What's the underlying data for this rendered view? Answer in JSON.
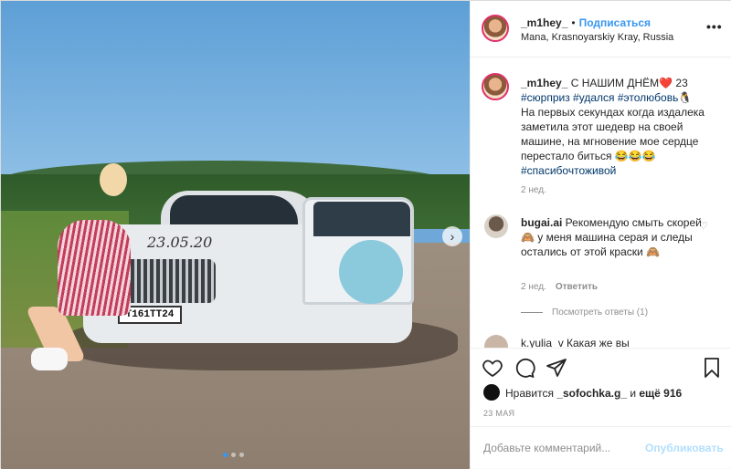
{
  "post": {
    "username": "_m1hey_",
    "separator": "•",
    "follow_label": "Подписаться",
    "location": "Mana, Krasnoyarskiy Kray, Russia",
    "more_icon": "more-horizontal-icon"
  },
  "photo": {
    "plate": "Т161ТТ24",
    "writing": "23.05.20",
    "carousel_next": "›",
    "carousel_total": 3,
    "carousel_index": 1
  },
  "caption": {
    "username": "_m1hey_",
    "text_main": " С НАШИМ ДНЁМ❤️ 23",
    "hashtags_1": "#сюрприз #удался #этолюбовь🐧",
    "body": "На первых секундах когда издалека заметила этот шедевр на своей машине, на мгновение мое сердце перестало биться 😂😂😂",
    "hashtags_2": "#спасибочтоживой",
    "time": "2 нед."
  },
  "reply": {
    "username": "bugai.ai",
    "text": " Рекомендую смыть скорей🙈 у меня машина серая и следы остались от этой краски 🙈",
    "time": "2 нед.",
    "reply_label": "Ответить",
    "view_replies": "Посмотреть ответы (1)"
  },
  "next_comment": {
    "text": "k.yulia_v Какая же вы"
  },
  "likes": {
    "prefix": "Нравится ",
    "user": "_sofochka.g_",
    "middle": " и ",
    "count": "ещё 916"
  },
  "date": "23 МАЯ",
  "comment_box": {
    "placeholder": "Добавьте комментарий...",
    "post_label": "Опубликовать"
  },
  "colors": {
    "accent": "#3897f0",
    "muted": "#8e8e8e"
  }
}
